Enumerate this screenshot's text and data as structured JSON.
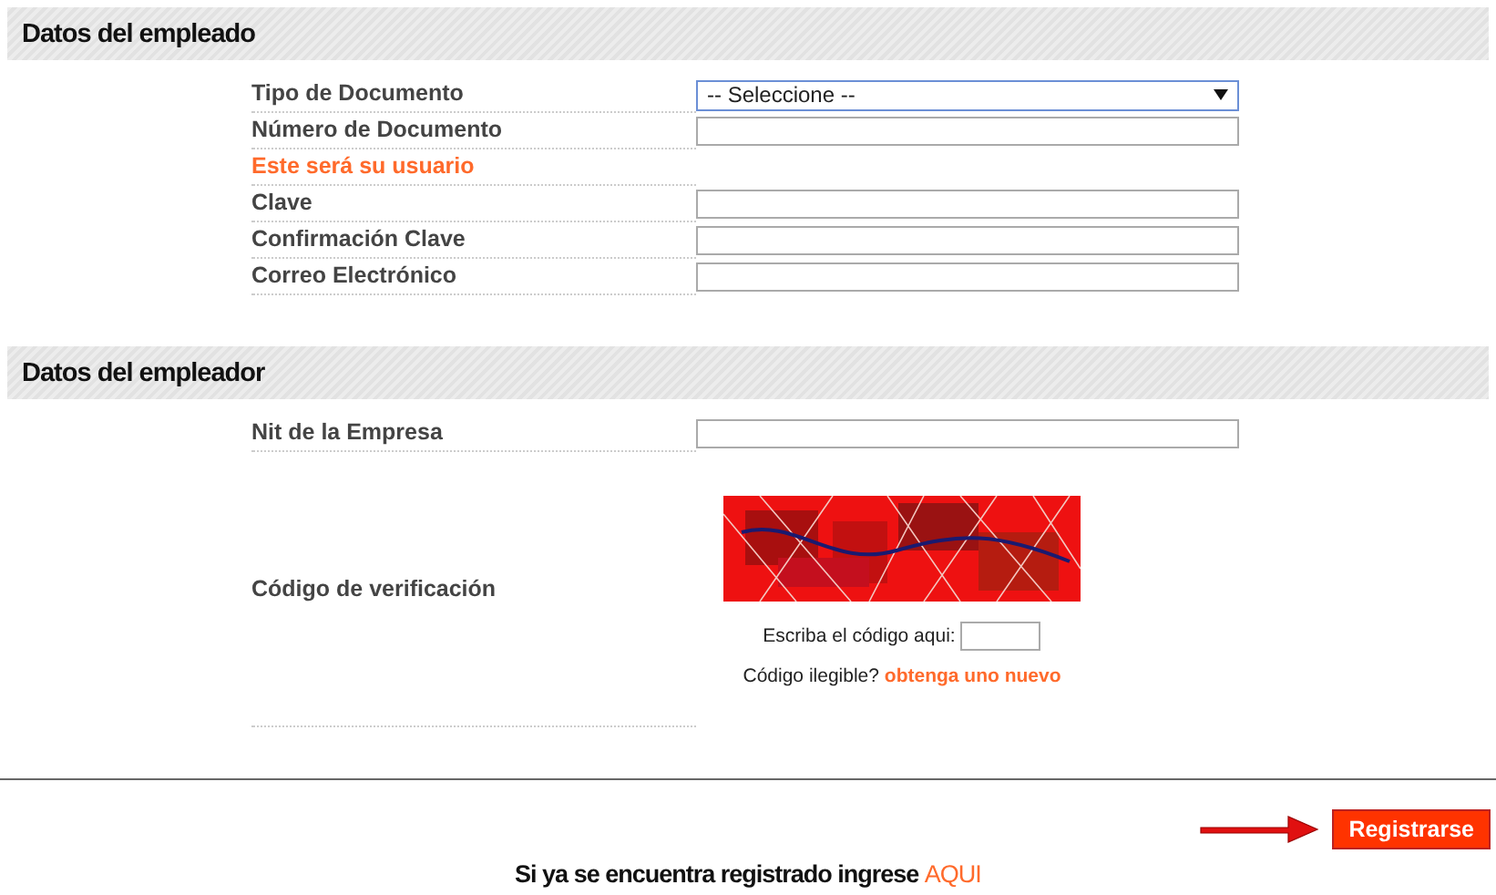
{
  "sections": [
    {
      "title": "Datos del empleado",
      "rows": [
        {
          "kind": "select",
          "label": "Tipo de Documento",
          "value": "-- Seleccione --"
        },
        {
          "kind": "input",
          "label": "Número de Documento"
        },
        {
          "kind": "note",
          "label": "Este será su usuario"
        },
        {
          "kind": "input",
          "label": "Clave"
        },
        {
          "kind": "input",
          "label": "Confirmación Clave"
        },
        {
          "kind": "input",
          "label": "Correo Electrónico"
        }
      ]
    },
    {
      "title": "Datos del empleador",
      "rows": [
        {
          "kind": "input",
          "label": "Nit de la Empresa"
        },
        {
          "kind": "captcha",
          "label": "Código de verificación",
          "prompt": "Escriba el código aqui:",
          "refresh_prompt": "Código ilegible?",
          "refresh_link": "obtenga uno nuevo"
        }
      ]
    }
  ],
  "footer": {
    "register_button": "Registrarse",
    "login_prompt": "Si ya se encuentra registrado ingrese",
    "login_link": "AQUI"
  }
}
